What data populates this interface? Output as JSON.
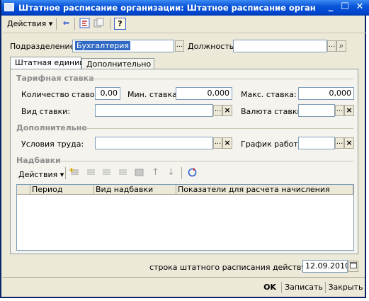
{
  "window": {
    "title": "Штатное расписание организации: Штатное расписание организаций:",
    "min_glyph": "_",
    "max_glyph": "☐",
    "close_glyph": "✕"
  },
  "toolbar": {
    "actions_label": "Действия",
    "dropdown_glyph": "▾",
    "back_icon_glyph": "⇐",
    "help_glyph": "?"
  },
  "header": {
    "department_label": "Подразделение:",
    "department_value": "Бухгалтерия",
    "position_label": "Должность:",
    "position_value": ""
  },
  "tabs": [
    {
      "label": "Штатная единица"
    },
    {
      "label": "Дополнительно"
    }
  ],
  "sections": {
    "tariff": "Тарифная ставка",
    "additional": "Дополнительно",
    "allowances": "Надбавки"
  },
  "tariff": {
    "count_label": "Количество ставок:",
    "count_value": "0,00",
    "min_label": "Мин. ставка:",
    "min_value": "0,000",
    "max_label": "Макс. ставка:",
    "max_value": "0,000",
    "rate_type_label": "Вид ставки:",
    "rate_type_value": "",
    "currency_label": "Валюта ставки:",
    "currency_value": ""
  },
  "additional": {
    "labor_label": "Условия труда:",
    "labor_value": "",
    "schedule_label": "График работы:",
    "schedule_value": ""
  },
  "allowances": {
    "actions_label": "Действия",
    "columns": [
      "Период",
      "Вид надбавки",
      "Показатели для расчета начисления"
    ]
  },
  "footer": {
    "effective_label": "строка штатного расписания действует с:",
    "effective_date": "12.09.2010",
    "ok_label": "OK",
    "save_label": "Записать",
    "close_label": "Закрыть"
  },
  "common": {
    "ellipsis": "...",
    "clear": "×",
    "search": "⌕"
  }
}
